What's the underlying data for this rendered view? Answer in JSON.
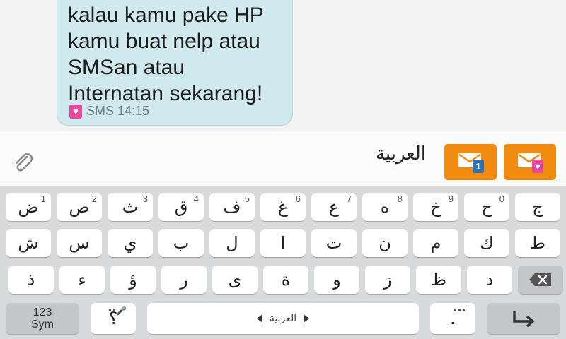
{
  "message": {
    "lines": [
      "kalau kamu pake HP",
      "kamu buat nelp atau",
      "SMSan atau",
      "Internatan sekarang!"
    ],
    "meta": "SMS 14:15"
  },
  "composer": {
    "text": "العربية"
  },
  "send_buttons": [
    {
      "sim_label": "1"
    },
    {
      "sim_label": "♥"
    }
  ],
  "keyboard": {
    "row1": [
      {
        "char": "ض",
        "hint": "1"
      },
      {
        "char": "ص",
        "hint": "2"
      },
      {
        "char": "ث",
        "hint": "3"
      },
      {
        "char": "ق",
        "hint": "4"
      },
      {
        "char": "ف",
        "hint": "5"
      },
      {
        "char": "غ",
        "hint": "6"
      },
      {
        "char": "ع",
        "hint": "7"
      },
      {
        "char": "ه",
        "hint": "8"
      },
      {
        "char": "خ",
        "hint": "9"
      },
      {
        "char": "ح",
        "hint": "0"
      },
      {
        "char": "ج",
        "hint": ""
      }
    ],
    "row2": [
      "ش",
      "س",
      "ي",
      "ب",
      "ل",
      "ا",
      "ت",
      "ن",
      "م",
      "ك",
      "ط"
    ],
    "row3": [
      "ذ",
      "ء",
      "ؤ",
      "ر",
      "ى",
      "ة",
      "و",
      "ز",
      "ظ",
      "د"
    ],
    "sym_top": "123",
    "sym_bottom": "Sym",
    "question": "؟",
    "space_label": "العربية",
    "period": "."
  },
  "colors": {
    "accent": "#f08b0f",
    "bubble": "#cfe9ee",
    "sim1": "#2f6fb3",
    "sim2": "#e7479c"
  }
}
